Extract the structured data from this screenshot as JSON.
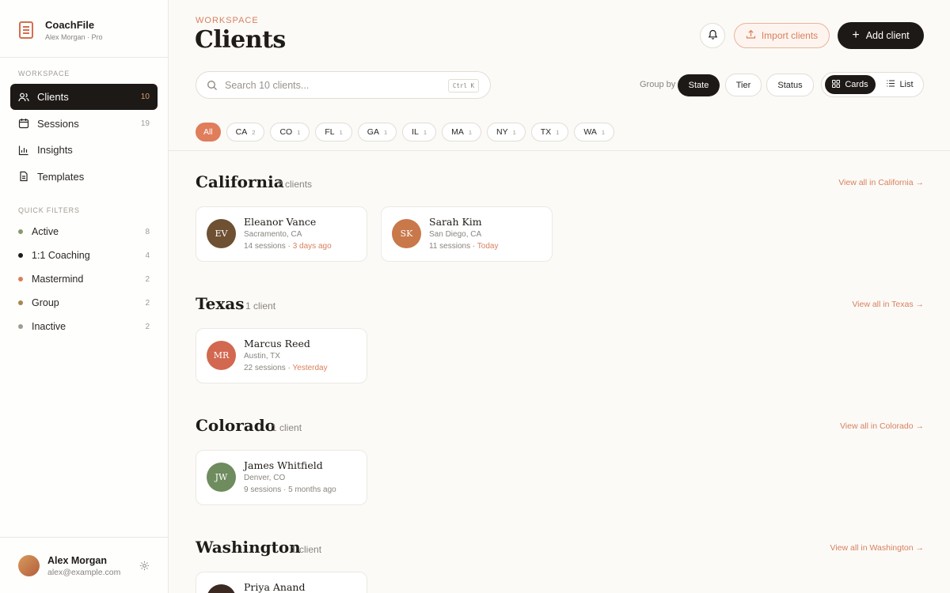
{
  "brand": {
    "name": "CoachFile",
    "subtitle": "Alex Morgan · Pro"
  },
  "sidebar": {
    "workspace_label": "WORKSPACE",
    "nav": [
      {
        "label": "Clients",
        "count": "10",
        "icon": "users-icon",
        "active": true
      },
      {
        "label": "Sessions",
        "count": "19",
        "icon": "calendar-icon"
      },
      {
        "label": "Insights",
        "count": "",
        "icon": "bar-chart-icon"
      },
      {
        "label": "Templates",
        "count": "",
        "icon": "document-icon"
      }
    ],
    "quick_filters_label": "QUICK FILTERS",
    "quick_filters": [
      {
        "label": "Active",
        "count": "8",
        "color": "#8a9a6e"
      },
      {
        "label": "1:1 Coaching",
        "count": "4",
        "color": "#1f1b17"
      },
      {
        "label": "Mastermind",
        "count": "2",
        "color": "#d9805d"
      },
      {
        "label": "Group",
        "count": "2",
        "color": "#a8864e"
      },
      {
        "label": "Inactive",
        "count": "2",
        "color": "#a29b93"
      }
    ],
    "user": {
      "name": "Alex Morgan",
      "email": "alex@example.com"
    }
  },
  "header": {
    "eyebrow": "WORKSPACE",
    "title": "Clients",
    "import_label": "Import clients",
    "add_label": "Add client"
  },
  "search": {
    "placeholder": "Search 10 clients...",
    "value": "",
    "shortcut": "Ctrl K"
  },
  "group_by": {
    "label": "Group by",
    "options": [
      "State",
      "Tier",
      "Status"
    ],
    "selected": "State"
  },
  "view": {
    "options": [
      "Cards",
      "List"
    ],
    "selected": "Cards"
  },
  "state_filters": [
    {
      "label": "All",
      "count": ""
    },
    {
      "label": "CA",
      "count": "2"
    },
    {
      "label": "CO",
      "count": "1"
    },
    {
      "label": "FL",
      "count": "1"
    },
    {
      "label": "GA",
      "count": "1"
    },
    {
      "label": "IL",
      "count": "1"
    },
    {
      "label": "MA",
      "count": "1"
    },
    {
      "label": "NY",
      "count": "1"
    },
    {
      "label": "TX",
      "count": "1"
    },
    {
      "label": "WA",
      "count": "1"
    }
  ],
  "groups": [
    {
      "name": "California",
      "count": "2 clients",
      "view_all": "View all in California →",
      "clients": [
        {
          "initials": "EV",
          "name": "Eleanor Vance",
          "location": "Sacramento, CA",
          "sessions": "14 sessions · ",
          "last": "3 days ago",
          "last_highlight": true,
          "color": "#6e5032"
        },
        {
          "initials": "SK",
          "name": "Sarah Kim",
          "location": "San Diego, CA",
          "sessions": "11 sessions · ",
          "last": "Today",
          "last_highlight": true,
          "color": "#c9784a"
        }
      ]
    },
    {
      "name": "Texas",
      "count": "1 client",
      "view_all": "View all in Texas →",
      "clients": [
        {
          "initials": "MR",
          "name": "Marcus Reed",
          "location": "Austin, TX",
          "sessions": "22 sessions · ",
          "last": "Yesterday",
          "last_highlight": true,
          "color": "#d2684f"
        }
      ]
    },
    {
      "name": "Colorado",
      "count": "1 client",
      "view_all": "View all in Colorado →",
      "clients": [
        {
          "initials": "JW",
          "name": "James Whitfield",
          "location": "Denver, CO",
          "sessions": "9 sessions · ",
          "last": "5 months ago",
          "last_highlight": false,
          "color": "#6e8c5e"
        }
      ]
    },
    {
      "name": "Washington",
      "count": "1 client",
      "view_all": "View all in Washington →",
      "clients": [
        {
          "initials": "PA",
          "name": "Priya Anand",
          "location": "",
          "sessions": "",
          "last": "",
          "last_highlight": false,
          "color": "#3a2a22"
        }
      ]
    }
  ]
}
